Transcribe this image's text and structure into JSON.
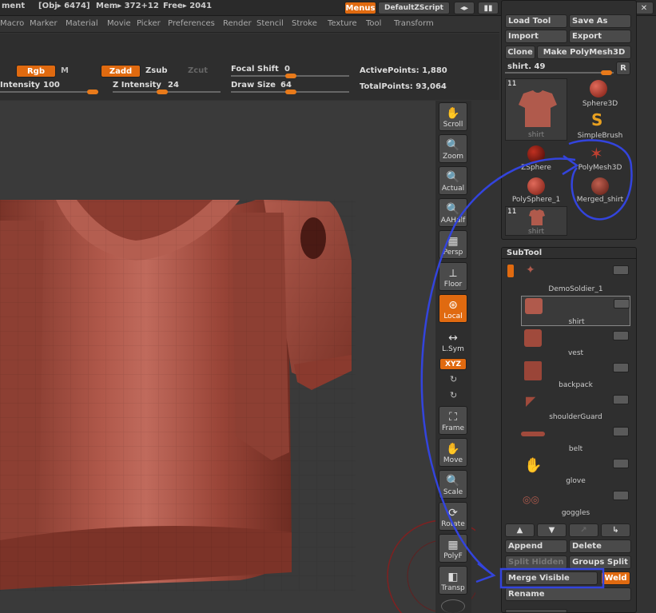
{
  "topbar": {
    "left_label": "ment",
    "obj_info": "[Obj▸ 6474]",
    "mem_info": "Mem▸ 372+12",
    "free_info": "Free▸ 2041",
    "menus_btn": "Menus",
    "script_btn": "DefaultZScript"
  },
  "menubar": {
    "items": [
      "Macro",
      "Marker",
      "Material",
      "Movie",
      "Picker",
      "Preferences",
      "Render",
      "Stencil",
      "Stroke",
      "Texture",
      "Tool",
      "Transform"
    ]
  },
  "shelf": {
    "rgb": "Rgb",
    "m": "M",
    "zadd": "Zadd",
    "zsub": "Zsub",
    "zcut": "Zcut",
    "intensity_label": "Intensity",
    "intensity_value": "100",
    "z_intensity_label": "Z Intensity",
    "z_intensity_value": "24",
    "focal_label": "Focal Shift",
    "focal_value": "0",
    "draw_label": "Draw Size",
    "draw_value": "64",
    "active_points": "ActivePoints: 1,880",
    "total_points": "TotalPoints: 93,064"
  },
  "vtoolbar": {
    "items": [
      "Scroll",
      "Zoom",
      "Actual",
      "AAHalf",
      "Persp",
      "Floor",
      "Local",
      "L.Sym",
      "XYZ",
      "Frame",
      "Move",
      "Scale",
      "Rotate",
      "PolyF",
      "Transp"
    ]
  },
  "tool_panel": {
    "load_tool": "Load Tool",
    "save_as": "Save As",
    "import": "Import",
    "export": "Export",
    "clone": "Clone",
    "make_polymesh": "Make PolyMesh3D",
    "current_tool": "shirt. 49",
    "r_btn": "R",
    "thumb_count_1": "11",
    "thumb_count_2": "11",
    "tools": [
      "shirt",
      "Sphere3D",
      "SimpleBrush",
      "ZSphere",
      "PolyMesh3D",
      "PolySphere_1",
      "Merged_shirt",
      "shirt"
    ]
  },
  "subtool": {
    "title": "SubTool",
    "items": [
      "DemoSoldier_1",
      "shirt",
      "vest",
      "backpack",
      "shoulderGuard",
      "belt",
      "glove",
      "goggles"
    ],
    "append": "Append",
    "delete": "Delete",
    "split_hidden": "Split Hidden",
    "groups_split": "Groups Split",
    "merge_visible": "Merge Visible",
    "weld": "Weld",
    "rename": "Rename"
  },
  "colors": {
    "accent": "#e06a10",
    "annotation": "#3344dd",
    "mesh": "#a04a3c"
  }
}
